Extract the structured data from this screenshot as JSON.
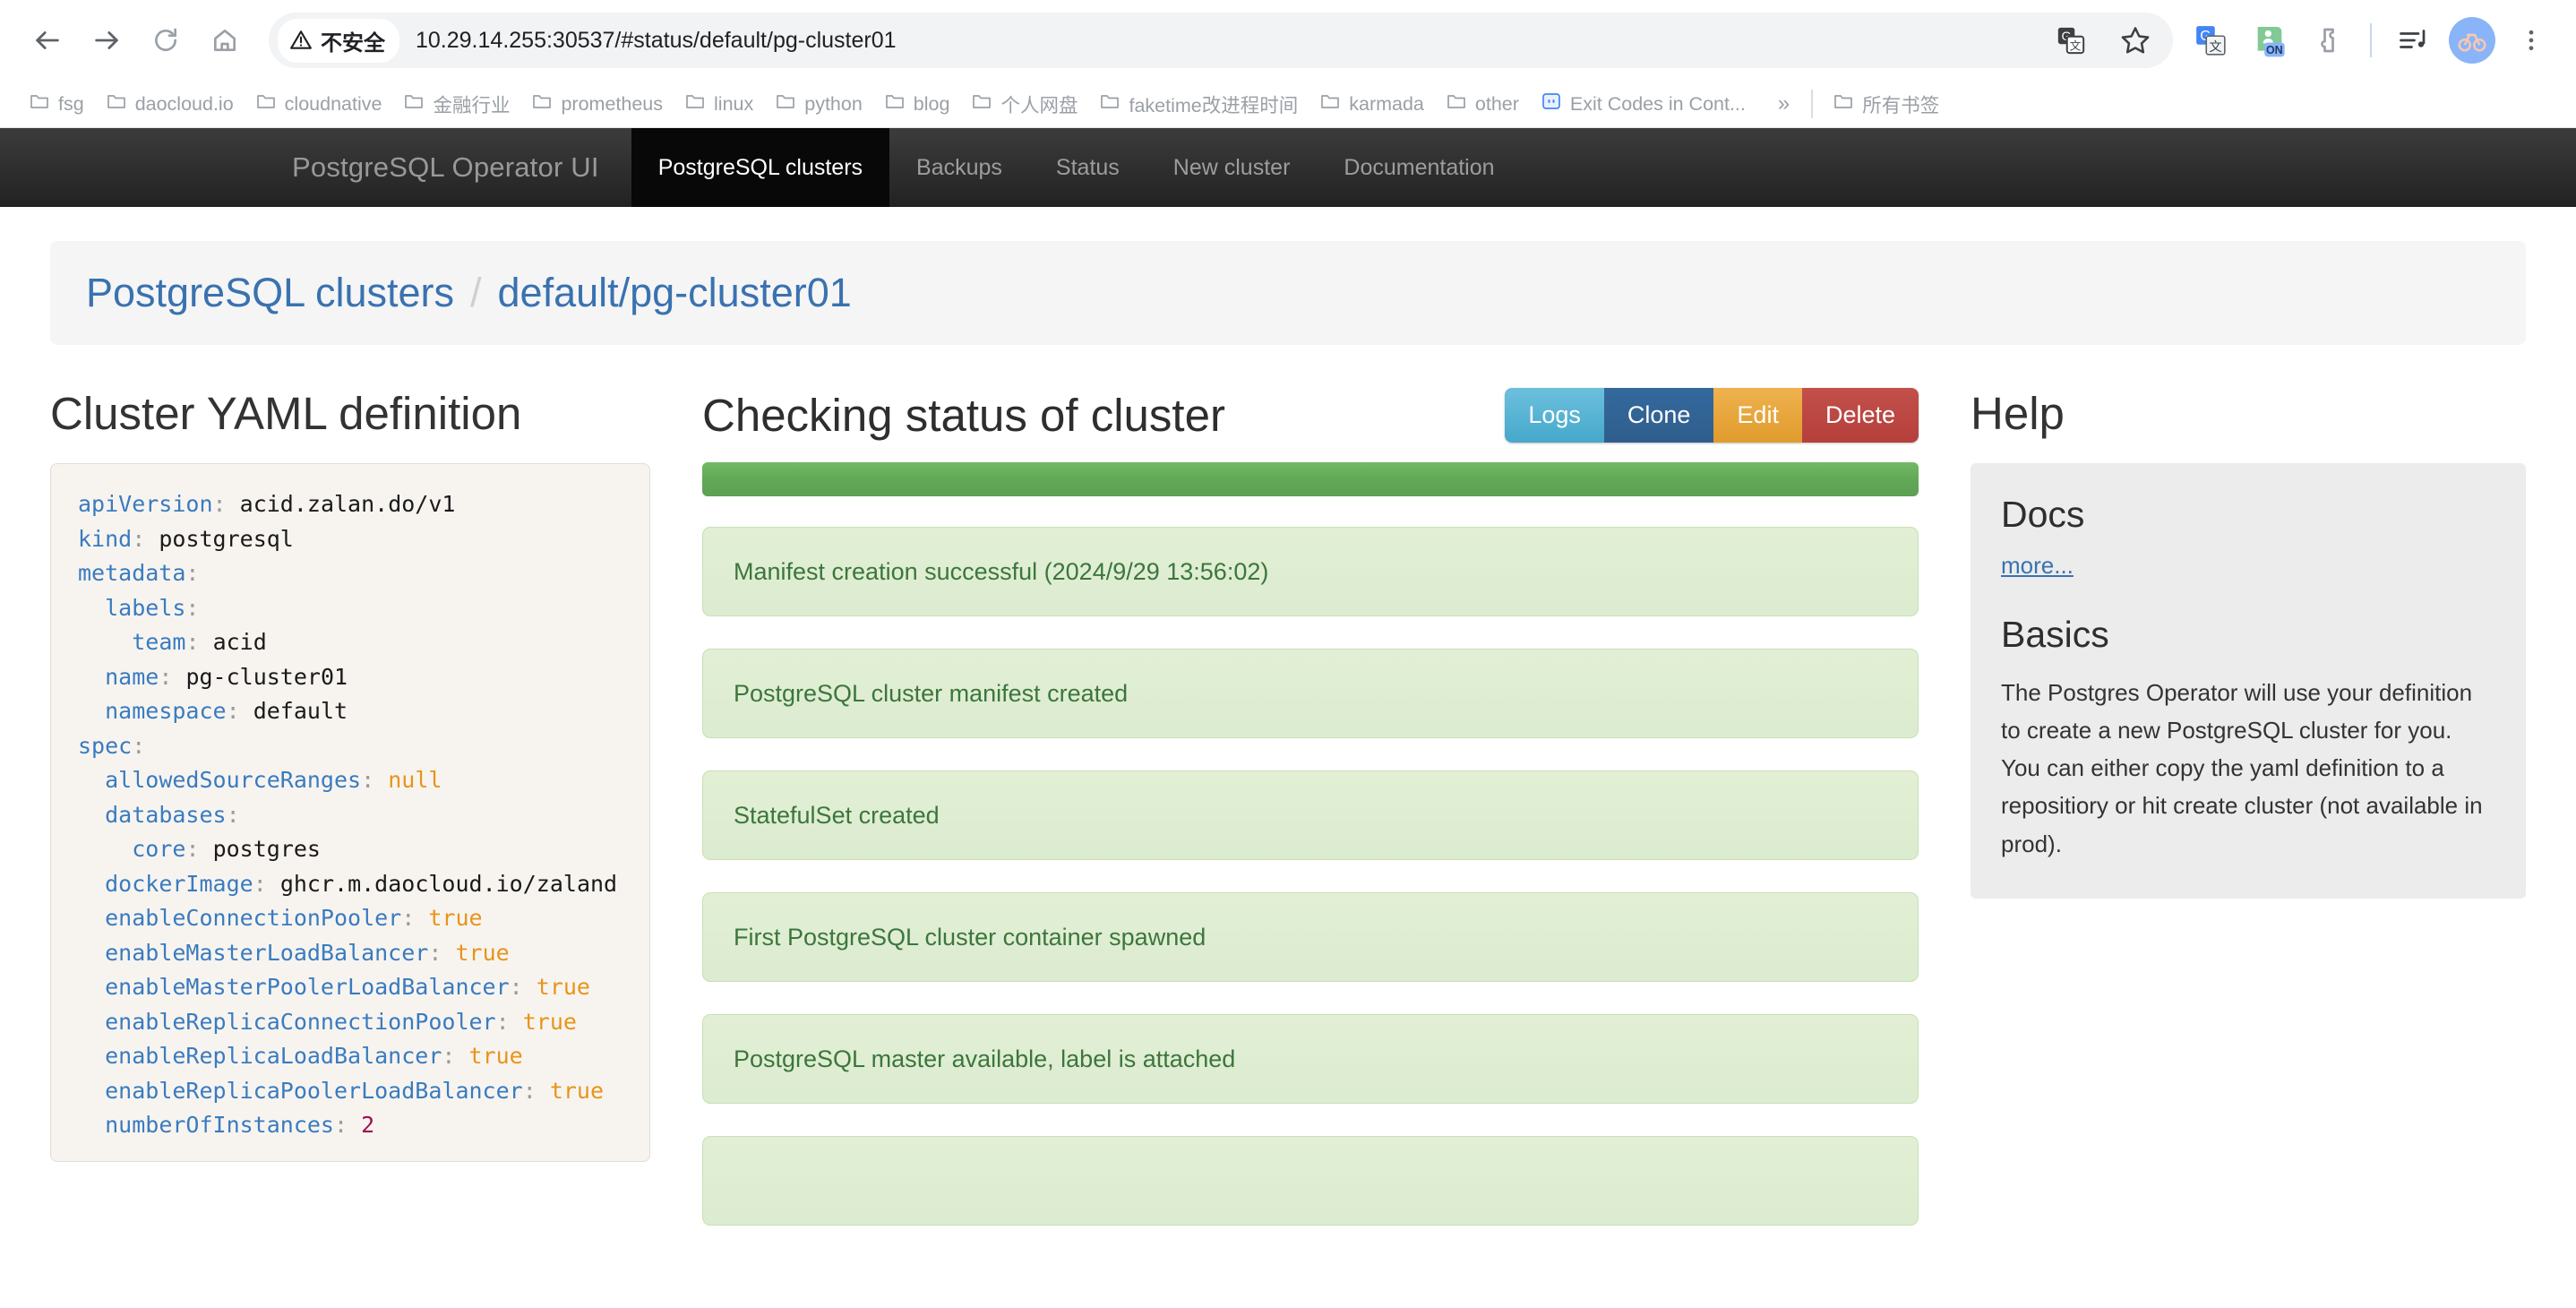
{
  "browser": {
    "nav": {
      "back": "back-arrow",
      "forward": "forward-arrow",
      "reload": "reload",
      "home": "home"
    },
    "security_label": "不安全",
    "url": "10.29.14.255:30537/#status/default/pg-cluster01",
    "bookmarks": [
      {
        "label": "fsg",
        "icon": "folder-icon"
      },
      {
        "label": "daocloud.io",
        "icon": "folder-icon"
      },
      {
        "label": "cloudnative",
        "icon": "folder-icon"
      },
      {
        "label": "金融行业",
        "icon": "folder-icon"
      },
      {
        "label": "prometheus",
        "icon": "folder-icon"
      },
      {
        "label": "linux",
        "icon": "folder-icon"
      },
      {
        "label": "python",
        "icon": "folder-icon"
      },
      {
        "label": "blog",
        "icon": "folder-icon"
      },
      {
        "label": "个人网盘",
        "icon": "folder-icon"
      },
      {
        "label": "faketime改进程时间",
        "icon": "folder-icon"
      },
      {
        "label": "karmada",
        "icon": "folder-icon"
      },
      {
        "label": "other",
        "icon": "folder-icon"
      },
      {
        "label": "Exit Codes in Cont...",
        "icon": "page-icon"
      }
    ],
    "overflow_label": "»",
    "all_bookmarks_label": "所有书签"
  },
  "app": {
    "brand": "PostgreSQL Operator UI",
    "nav_items": [
      {
        "label": "PostgreSQL clusters",
        "active": true
      },
      {
        "label": "Backups",
        "active": false
      },
      {
        "label": "Status",
        "active": false
      },
      {
        "label": "New cluster",
        "active": false
      },
      {
        "label": "Documentation",
        "active": false
      }
    ]
  },
  "breadcrumb": {
    "root": "PostgreSQL clusters",
    "separator": "/",
    "current": "default/pg-cluster01"
  },
  "yaml_panel": {
    "title": "Cluster YAML definition",
    "lines": [
      {
        "indent": 0,
        "key": "apiVersion",
        "value": "acid.zalan.do/v1",
        "type": "string"
      },
      {
        "indent": 0,
        "key": "kind",
        "value": "postgresql",
        "type": "string"
      },
      {
        "indent": 0,
        "key": "metadata",
        "value": "",
        "type": "map"
      },
      {
        "indent": 1,
        "key": "labels",
        "value": "",
        "type": "map"
      },
      {
        "indent": 2,
        "key": "team",
        "value": "acid",
        "type": "string"
      },
      {
        "indent": 1,
        "key": "name",
        "value": "pg-cluster01",
        "type": "string"
      },
      {
        "indent": 1,
        "key": "namespace",
        "value": "default",
        "type": "string"
      },
      {
        "indent": 0,
        "key": "spec",
        "value": "",
        "type": "map"
      },
      {
        "indent": 1,
        "key": "allowedSourceRanges",
        "value": "null",
        "type": "bool"
      },
      {
        "indent": 1,
        "key": "databases",
        "value": "",
        "type": "map"
      },
      {
        "indent": 2,
        "key": "core",
        "value": "postgres",
        "type": "string"
      },
      {
        "indent": 1,
        "key": "dockerImage",
        "value": "ghcr.m.daocloud.io/zaland",
        "type": "string"
      },
      {
        "indent": 1,
        "key": "enableConnectionPooler",
        "value": "true",
        "type": "bool"
      },
      {
        "indent": 1,
        "key": "enableMasterLoadBalancer",
        "value": "true",
        "type": "bool"
      },
      {
        "indent": 1,
        "key": "enableMasterPoolerLoadBalancer",
        "value": "true",
        "type": "bool"
      },
      {
        "indent": 1,
        "key": "enableReplicaConnectionPooler",
        "value": "true",
        "type": "bool"
      },
      {
        "indent": 1,
        "key": "enableReplicaLoadBalancer",
        "value": "true",
        "type": "bool"
      },
      {
        "indent": 1,
        "key": "enableReplicaPoolerLoadBalancer",
        "value": "true",
        "type": "bool"
      },
      {
        "indent": 1,
        "key": "numberOfInstances",
        "value": "2",
        "type": "number"
      }
    ]
  },
  "status_panel": {
    "title": "Checking status of cluster",
    "buttons": [
      {
        "label": "Logs",
        "color": "#46a8cb"
      },
      {
        "label": "Clone",
        "color": "#34699e"
      },
      {
        "label": "Edit",
        "color": "#e09b2c"
      },
      {
        "label": "Delete",
        "color": "#b53f3b"
      }
    ],
    "progress": {
      "percent": 100,
      "color": "#62a857"
    },
    "messages": [
      "Manifest creation successful (2024/9/29 13:56:02)",
      "PostgreSQL cluster manifest created",
      "StatefulSet created",
      "First PostgreSQL cluster container spawned",
      "PostgreSQL master available, label is attached",
      ""
    ]
  },
  "help_panel": {
    "title": "Help",
    "docs_heading": "Docs",
    "docs_more": "more...",
    "basics_heading": "Basics",
    "basics_body": "The Postgres Operator will use your definition to create a new PostgreSQL cluster for you. You can either copy the yaml definition to a repositiory or hit create cluster (not available in prod)."
  }
}
